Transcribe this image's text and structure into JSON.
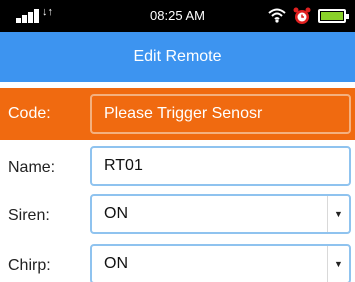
{
  "status_bar": {
    "time": "08:25 AM",
    "data_arrows": "↓↑",
    "battery_color": "#8ad12a",
    "icons": [
      "signal-icon",
      "data-arrows-icon",
      "wifi-icon",
      "alarm-clock-icon",
      "battery-icon"
    ]
  },
  "header": {
    "title": "Edit Remote",
    "background": "#3d94f0"
  },
  "form": {
    "code": {
      "label": "Code:",
      "value": "Please Trigger Senosr",
      "highlight_color": "#f06a10"
    },
    "name": {
      "label": "Name:",
      "value": "RT01"
    },
    "siren": {
      "label": "Siren:",
      "selected": "ON",
      "arrow": "▼"
    },
    "chirp": {
      "label": "Chirp:",
      "selected": "ON",
      "arrow": "▼"
    }
  }
}
